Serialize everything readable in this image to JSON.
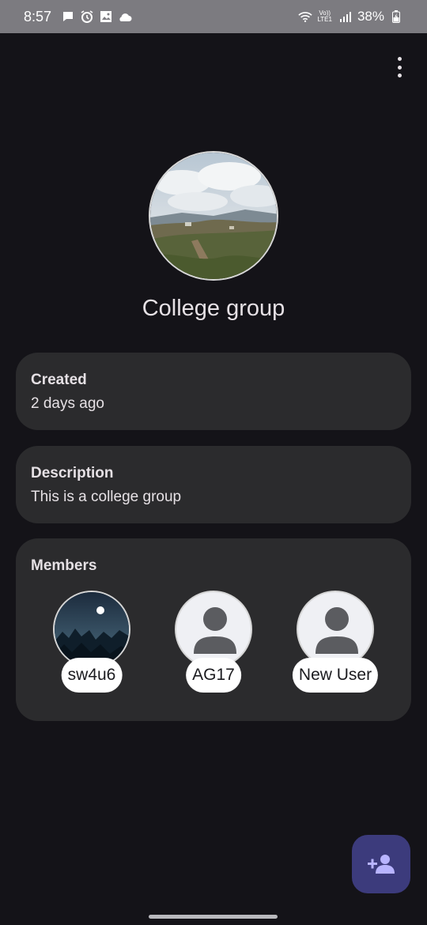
{
  "status_bar": {
    "time": "8:57",
    "lte_top": "Vo))",
    "lte_bottom": "LTE1",
    "battery": "38%"
  },
  "group": {
    "name": "College group"
  },
  "created": {
    "title": "Created",
    "value": "2 days ago"
  },
  "description": {
    "title": "Description",
    "value": "This is a college group"
  },
  "members": {
    "title": "Members",
    "items": [
      {
        "name": "sw4u6",
        "avatar": "night-landscape"
      },
      {
        "name": "AG17",
        "avatar": "default-person-icon"
      },
      {
        "name": "New User",
        "avatar": "default-person-icon"
      }
    ]
  },
  "fab": {
    "icon": "add-person-icon"
  },
  "colors": {
    "background": "#141318",
    "card": "#2b2b2d",
    "fab": "#3c3b7c",
    "fab_icon": "#b8b4ff",
    "status_bar": "#7c7b80"
  }
}
